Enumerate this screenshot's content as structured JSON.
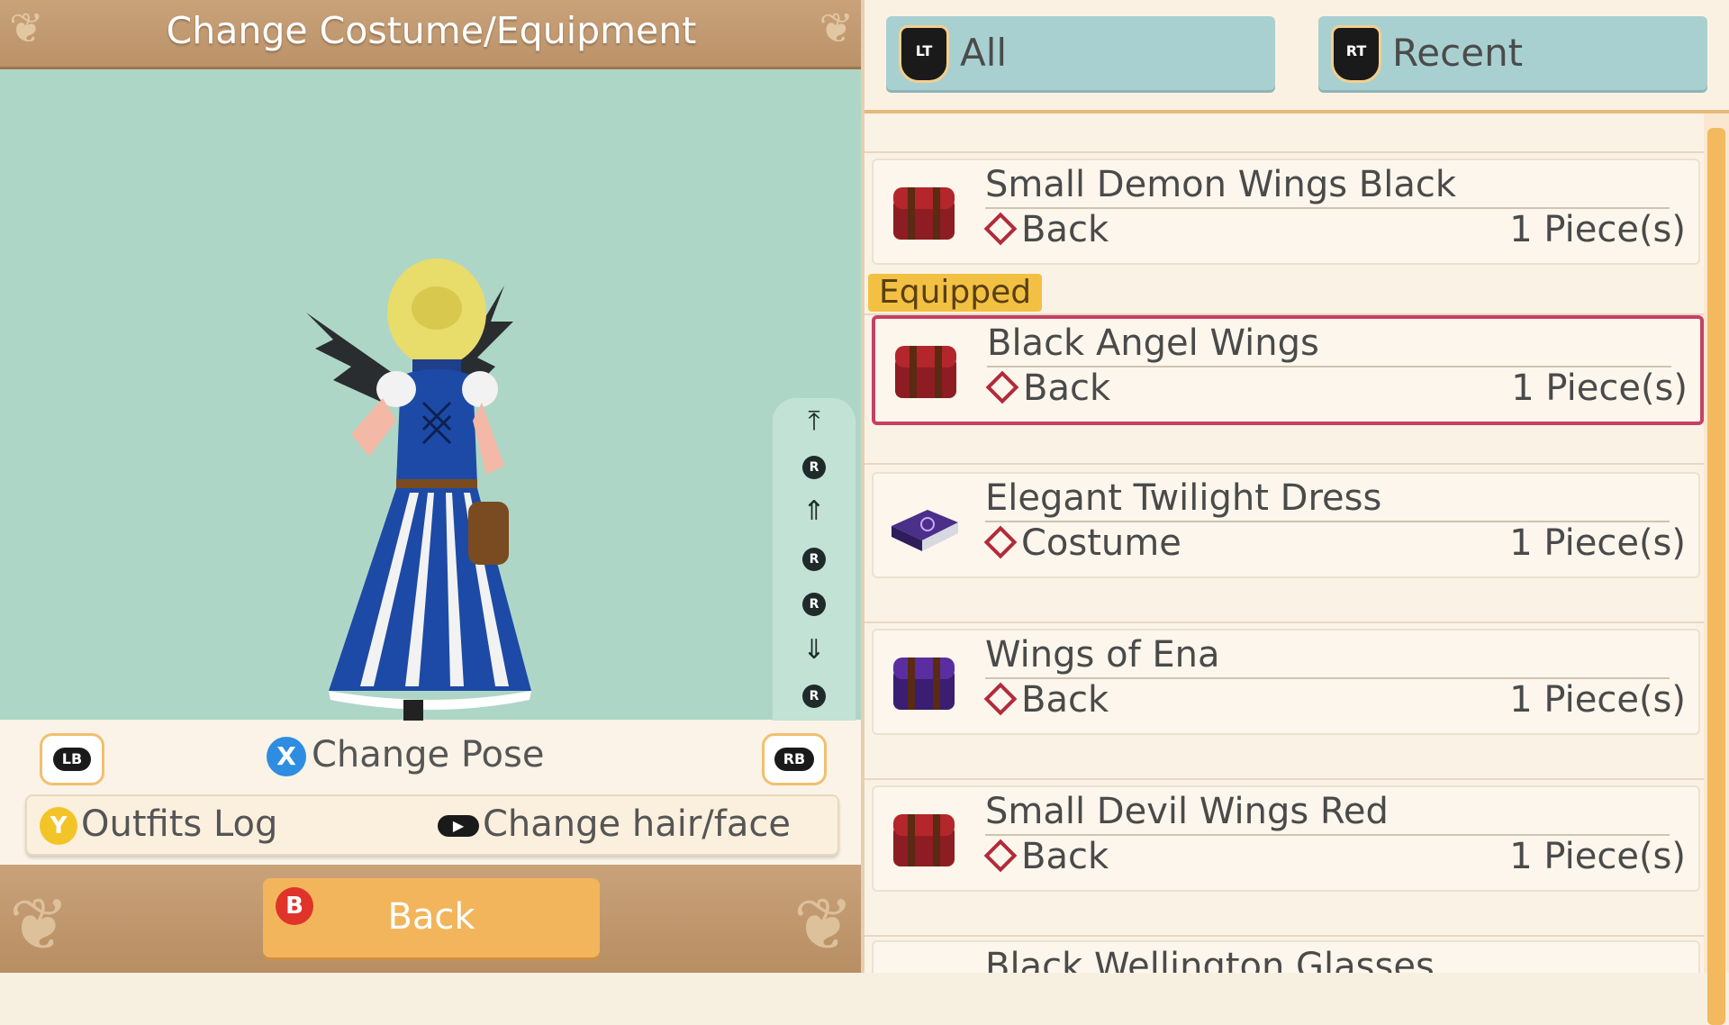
{
  "header": {
    "title": "Change Costume/Equipment"
  },
  "camera_controls": [
    "top-icon",
    "r-stick-up-icon",
    "zoom-in-icon",
    "r-stick-left-icon",
    "r-stick-right-icon",
    "zoom-out-icon",
    "r-stick-down-icon",
    "bottom-icon"
  ],
  "controls": {
    "lb": "LB",
    "rb": "RB",
    "x_key": "X",
    "pose": "Change Pose",
    "y_key": "Y",
    "outfits": "Outfits Log",
    "hairface": "Change hair/face"
  },
  "footer": {
    "b_key": "B",
    "back": "Back"
  },
  "tabs": [
    {
      "key": "LT",
      "label": "All"
    },
    {
      "key": "RT",
      "label": "Recent"
    }
  ],
  "equipped_label": "Equipped",
  "items": [
    {
      "name": "Small Demon Wings Black",
      "category": "Back",
      "qty": "1 Piece(s)",
      "icon": "red-chest-icon"
    },
    {
      "name": "Black Angel Wings",
      "category": "Back",
      "qty": "1 Piece(s)",
      "icon": "red-chest-icon"
    },
    {
      "name": "Elegant Twilight Dress",
      "category": "Costume",
      "qty": "1 Piece(s)",
      "icon": "purple-box-icon"
    },
    {
      "name": "Wings of Ena",
      "category": "Back",
      "qty": "1 Piece(s)",
      "icon": "purple-chest-icon"
    },
    {
      "name": "Small Devil Wings Red",
      "category": "Back",
      "qty": "1 Piece(s)",
      "icon": "red-chest-icon"
    },
    {
      "name": "Black Wellington Glasses",
      "category": "",
      "qty": "",
      "icon": ""
    }
  ],
  "colors": {
    "accent": "#f2b55c",
    "selected": "#c64064",
    "stage": "#aed6c6",
    "tab": "#a9d0d1"
  }
}
